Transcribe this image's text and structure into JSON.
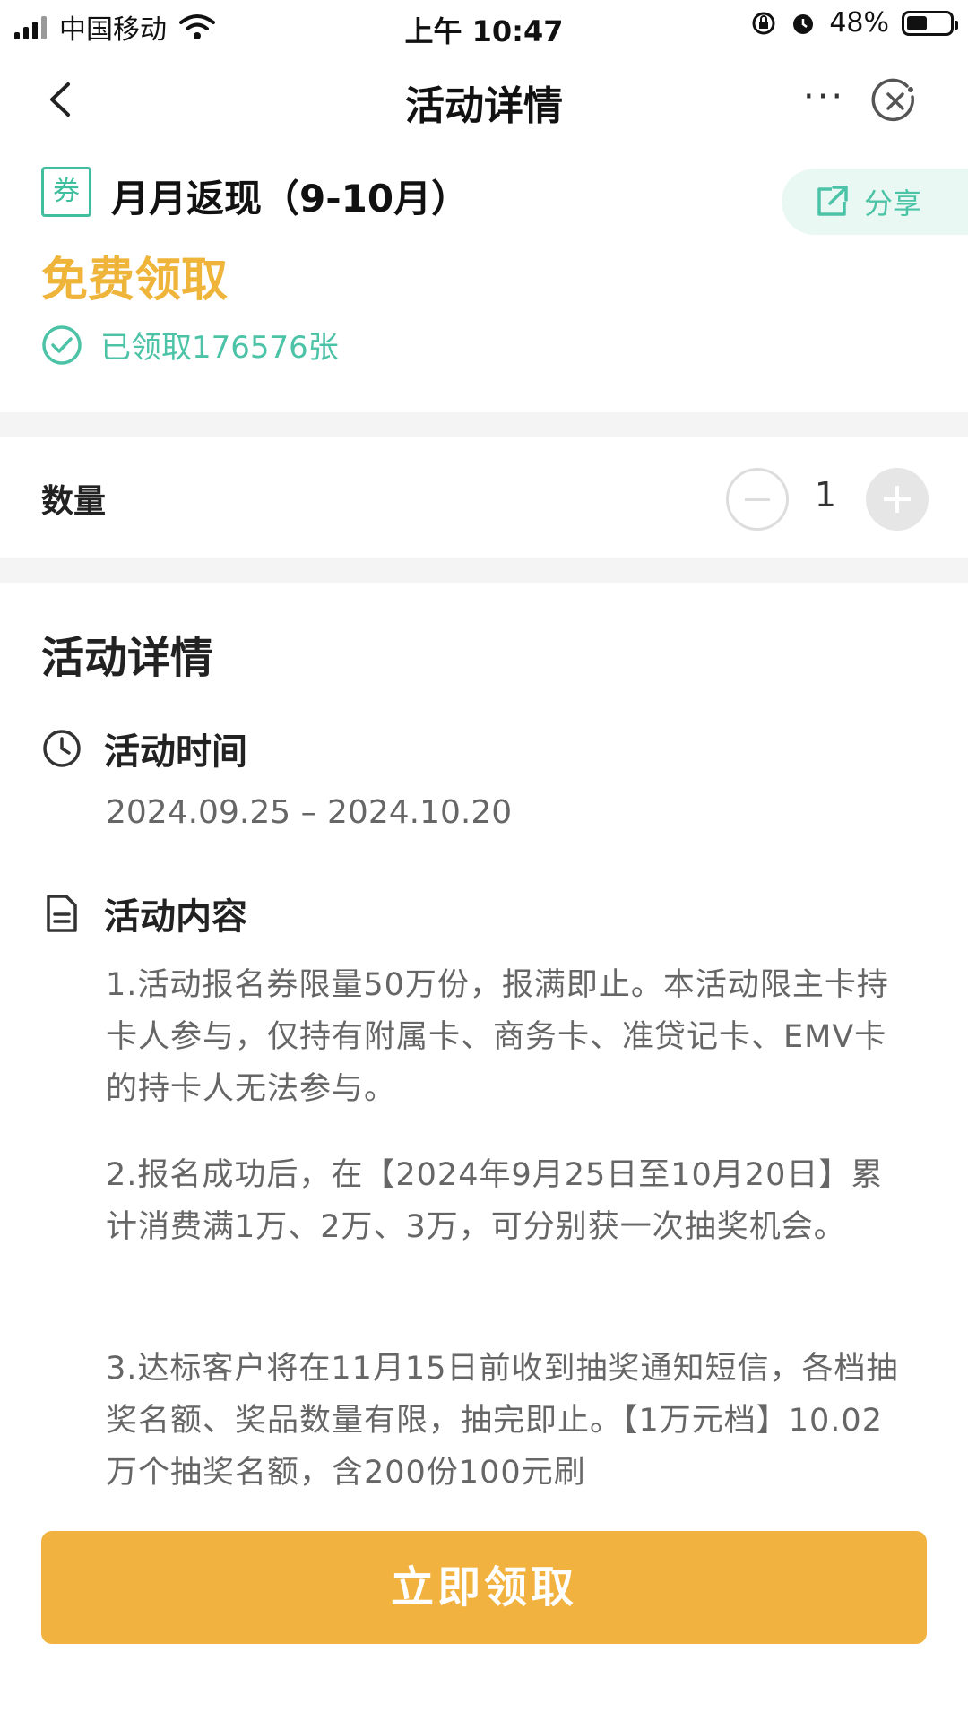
{
  "status": {
    "carrier": "中国移动",
    "time": "上午 10:47",
    "battery": "48%",
    "battery_level": 0.48
  },
  "nav": {
    "title": "活动详情",
    "more": "···"
  },
  "coupon": {
    "tag": "券",
    "title": "月月返现（9-10月）",
    "share_label": "分享",
    "price_label": "免费领取",
    "claimed_text": "已领取176576张"
  },
  "quantity": {
    "label": "数量",
    "value": "1"
  },
  "details": {
    "heading": "活动详情",
    "time_title": "活动时间",
    "time_range": "2024.09.25 – 2024.10.20",
    "content_title": "活动内容",
    "paragraphs": [
      "1.活动报名券限量50万份，报满即止。本活动限主卡持卡人参与，仅持有附属卡、商务卡、准贷记卡、EMV卡的持卡人无法参与。",
      "2.报名成功后，在【2024年9月25日至10月20日】累计消费满1万、2万、3万，可分别获一次抽奖机会。",
      "3.达标客户将在11月15日前收到抽奖通知短信，各档抽奖名额、奖品数量有限，抽完即止。【1万元档】10.02万个抽奖名额，含200份100元刷"
    ]
  },
  "cta": {
    "label": "立即领取"
  },
  "colors": {
    "accent_green": "#3fbf9e",
    "accent_orange": "#f2b23f",
    "price_yellow": "#efb43a"
  }
}
